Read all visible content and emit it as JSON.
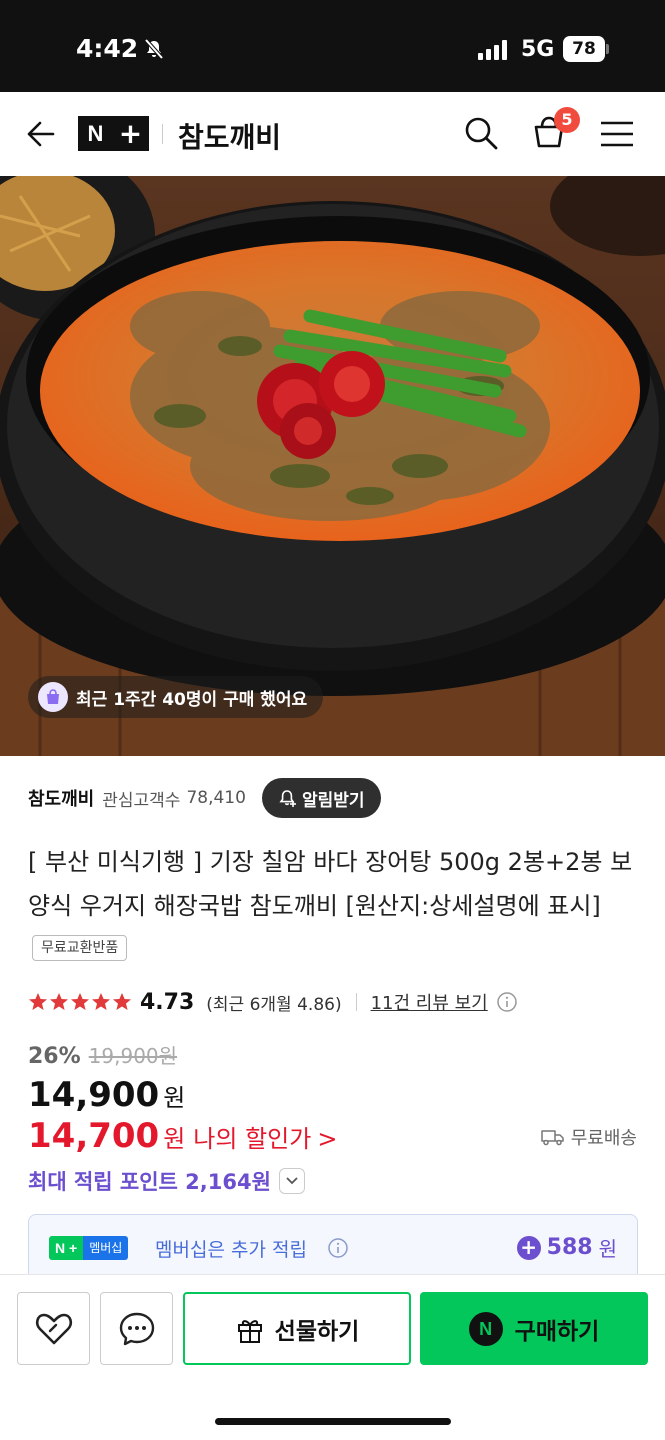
{
  "status_bar": {
    "time": "4:42",
    "network": "5G",
    "battery": "78"
  },
  "nav": {
    "brand_n": "N",
    "brand_plus": "+",
    "store_name": "참도깨비",
    "cart_count": "5"
  },
  "hero": {
    "purchase_notice": "최근 1주간 40명이 구매 했어요"
  },
  "seller": {
    "name": "참도깨비",
    "follower_label": "관심고객수",
    "follower_count": "78,410",
    "notify_label": "알림받기"
  },
  "product": {
    "title": "[ 부산 미식기행 ] 기장 칠암 바다 장어탕 500g 2봉+2봉 보양식 우거지 해장국밥 참도깨비 [원산지:상세설명에 표시]",
    "tag": "무료교환반품"
  },
  "rating": {
    "score": "4.73",
    "recent": "(최근 6개월 4.86)",
    "review_link": "11건 리뷰 보기",
    "stars": 5
  },
  "price": {
    "discount_pct": "26%",
    "original": "19,900원",
    "current": "14,900",
    "won": "원",
    "my_discount_price": "14,700",
    "my_discount_label": "나의 할인가",
    "my_discount_chevron": ">",
    "shipping": "무료배송"
  },
  "points": {
    "label": "최대 적립 포인트 2,164원"
  },
  "membership": {
    "badge_np": "N +",
    "badge_mb": "멤버십",
    "text": "멤버십은 추가 적립",
    "plus": "+",
    "value": "588",
    "won": "원"
  },
  "bottom_bar": {
    "gift_label": "선물하기",
    "buy_label": "구매하기",
    "buy_n": "N"
  },
  "colors": {
    "naver_green": "#03c75a",
    "accent_purple": "#6b4fce",
    "sale_red": "#e4182c",
    "badge_red": "#f04b3c"
  }
}
